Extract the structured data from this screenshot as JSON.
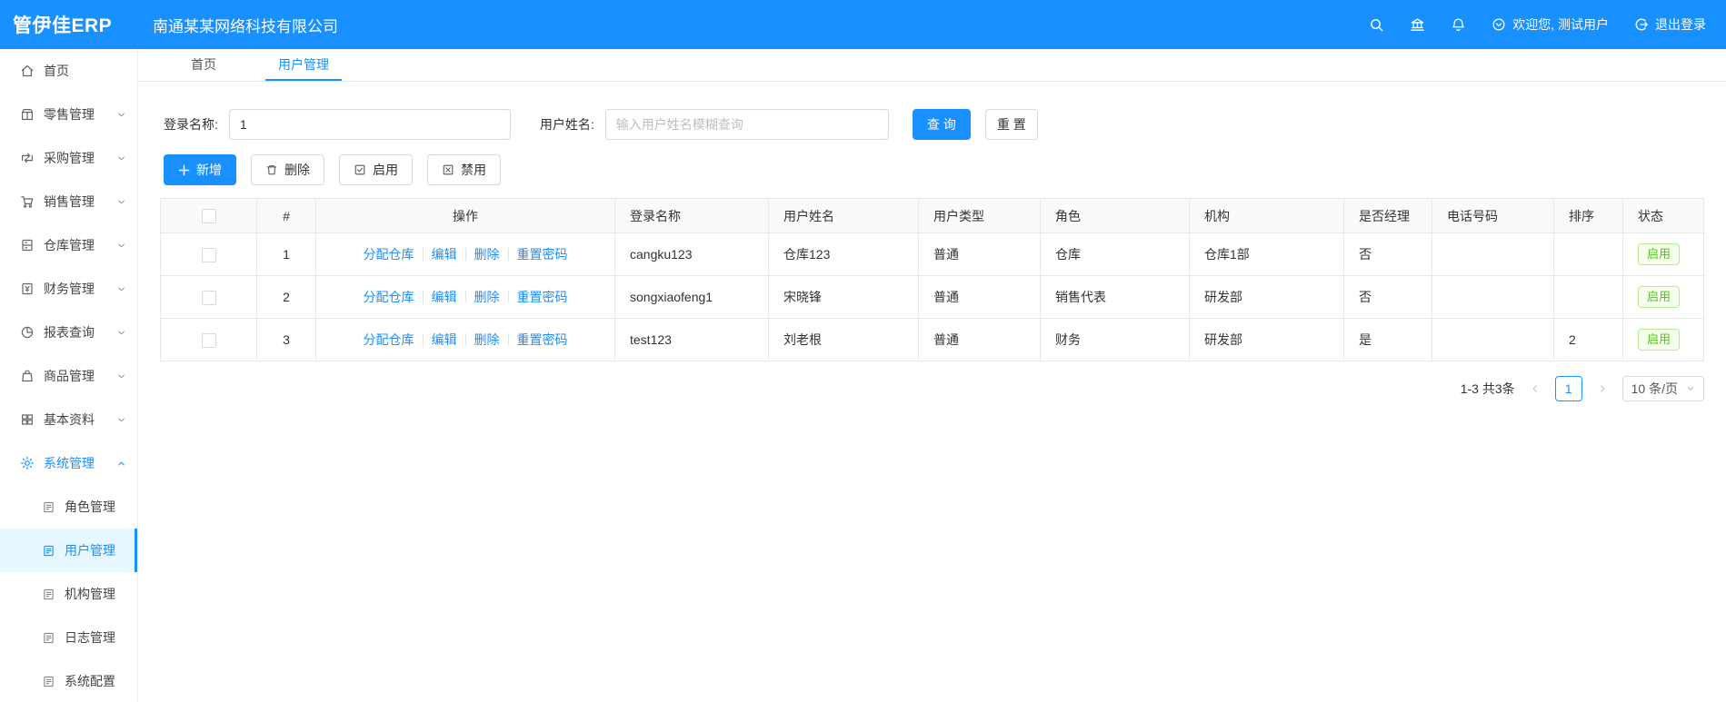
{
  "header": {
    "logo": "管伊佳ERP",
    "company": "南通某某网络科技有限公司",
    "welcome": "欢迎您, 测试用户",
    "logout_label": "退出登录"
  },
  "sidebar": {
    "items": [
      {
        "label": "首页"
      },
      {
        "label": "零售管理"
      },
      {
        "label": "采购管理"
      },
      {
        "label": "销售管理"
      },
      {
        "label": "仓库管理"
      },
      {
        "label": "财务管理"
      },
      {
        "label": "报表查询"
      },
      {
        "label": "商品管理"
      },
      {
        "label": "基本资料"
      },
      {
        "label": "系统管理"
      }
    ],
    "system_children": [
      {
        "label": "角色管理"
      },
      {
        "label": "用户管理"
      },
      {
        "label": "机构管理"
      },
      {
        "label": "日志管理"
      },
      {
        "label": "系统配置"
      }
    ]
  },
  "tabs": [
    {
      "label": "首页"
    },
    {
      "label": "用户管理"
    }
  ],
  "filters": {
    "login_label": "登录名称:",
    "login_value": "1",
    "name_label": "用户姓名:",
    "name_placeholder": "输入用户姓名模糊查询",
    "search_button": "查 询",
    "reset_button": "重 置"
  },
  "toolbar": {
    "add": "新增",
    "delete": "删除",
    "enable": "启用",
    "disable": "禁用"
  },
  "table": {
    "columns": [
      "#",
      "操作",
      "登录名称",
      "用户姓名",
      "用户类型",
      "角色",
      "机构",
      "是否经理",
      "电话号码",
      "排序",
      "状态"
    ],
    "action_links": [
      "分配仓库",
      "编辑",
      "删除",
      "重置密码"
    ],
    "rows": [
      {
        "index": "1",
        "login": "cangku123",
        "name": "仓库123",
        "type": "普通",
        "role": "仓库",
        "org": "仓库1部",
        "manager": "否",
        "phone": "",
        "sort": "",
        "status": "启用"
      },
      {
        "index": "2",
        "login": "songxiaofeng1",
        "name": "宋晓锋",
        "type": "普通",
        "role": "销售代表",
        "org": "研发部",
        "manager": "否",
        "phone": "",
        "sort": "",
        "status": "启用"
      },
      {
        "index": "3",
        "login": "test123",
        "name": "刘老根",
        "type": "普通",
        "role": "财务",
        "org": "研发部",
        "manager": "是",
        "phone": "",
        "sort": "2",
        "status": "启用"
      }
    ]
  },
  "pagination": {
    "total": "1-3 共3条",
    "current_page": "1",
    "page_size": "10 条/页"
  },
  "colors": {
    "primary": "#1890ff",
    "success": "#52c41a",
    "active_menu_bg": "#e6f7ff"
  }
}
